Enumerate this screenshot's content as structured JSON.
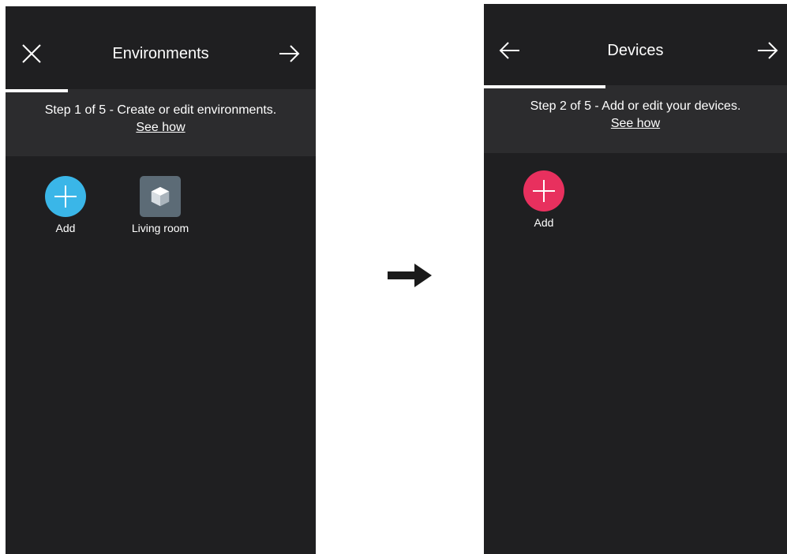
{
  "environments_screen": {
    "title": "Environments",
    "progress_fraction": 0.2,
    "step_text": "Step 1 of 5 - Create or edit environments.",
    "see_how": "See how",
    "items": [
      {
        "label": "Add",
        "icon": "plus-circle-icon",
        "color": "#3ab6e8"
      },
      {
        "label": "Living room",
        "icon": "cube-icon",
        "color": "#5c6b76"
      }
    ]
  },
  "devices_screen": {
    "title": "Devices",
    "progress_fraction": 0.4,
    "step_text": "Step 2 of 5 - Add or edit your devices.",
    "see_how": "See how",
    "items": [
      {
        "label": "Add",
        "icon": "plus-circle-icon",
        "color": "#e8305e"
      }
    ]
  },
  "colors": {
    "screen_background": "#1f1f21",
    "step_bar_background": "#2c2c2e",
    "text": "#ffffff"
  }
}
